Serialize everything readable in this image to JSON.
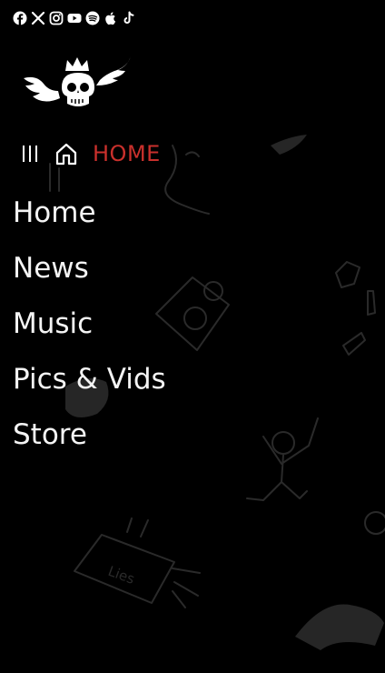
{
  "social": [
    {
      "icon": "facebook-icon"
    },
    {
      "icon": "x-icon"
    },
    {
      "icon": "instagram-icon"
    },
    {
      "icon": "youtube-icon"
    },
    {
      "icon": "spotify-icon"
    },
    {
      "icon": "apple-icon"
    },
    {
      "icon": "tiktok-icon"
    }
  ],
  "toolbar": {
    "breadcrumb": "HOME"
  },
  "nav": {
    "items": [
      "Home",
      "News",
      "Music",
      "Pics & Vids",
      "Store"
    ]
  },
  "colors": {
    "background": "#000000",
    "accent": "#c9302c",
    "text": "#f4f4f4"
  },
  "doodle_text": "Lies"
}
